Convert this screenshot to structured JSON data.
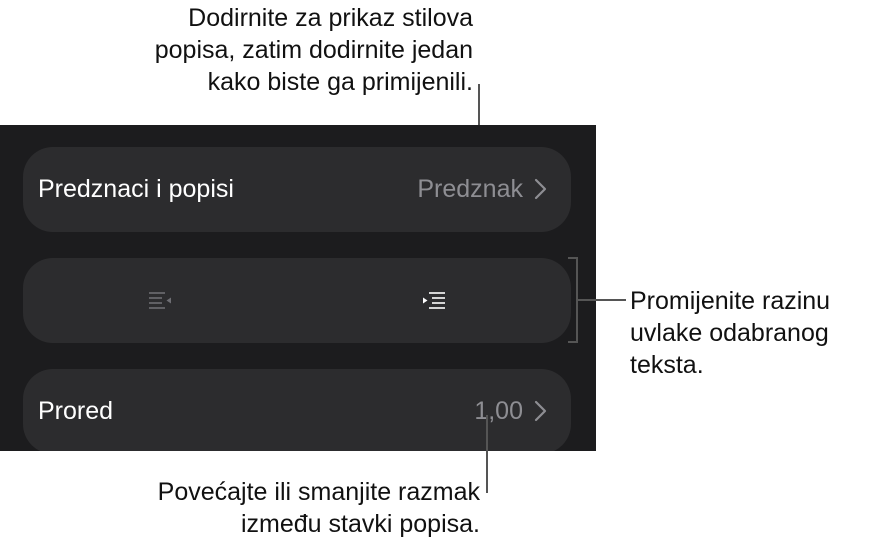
{
  "bullets_row": {
    "label": "Predznaci i popisi",
    "value": "Predznak"
  },
  "indent_row": {
    "decrease_icon": "outdent-icon",
    "increase_icon": "indent-icon"
  },
  "spacing_row": {
    "label": "Prored",
    "value": "1,00"
  },
  "callouts": {
    "top": {
      "line1": "Dodirnite za prikaz stilova",
      "line2": "popisa, zatim dodirnite jedan",
      "line3": "kako biste ga primijenili."
    },
    "right": {
      "line1": "Promijenite razinu",
      "line2": "uvlake odabranog",
      "line3": "teksta."
    },
    "bottom": {
      "line1": "Povećajte ili smanjite razmak",
      "line2": "između stavki popisa."
    }
  },
  "colors": {
    "panel_bg": "#1c1c1e",
    "row_bg": "#2c2c2e",
    "label": "#ffffff",
    "value": "#8e8e93"
  }
}
